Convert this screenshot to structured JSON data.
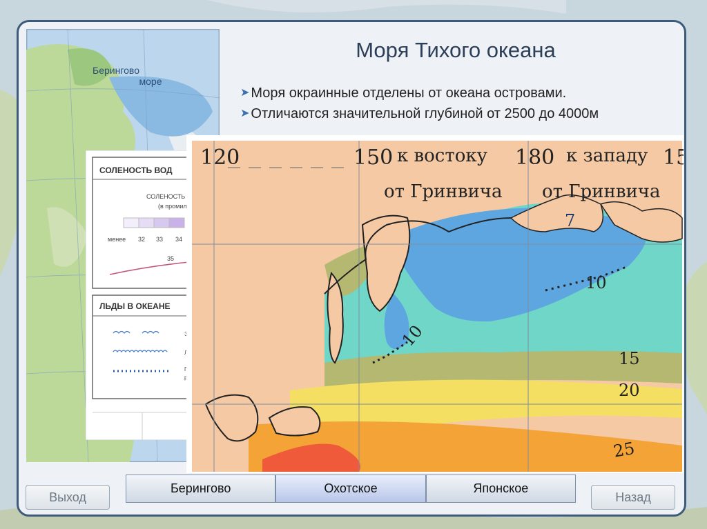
{
  "slide": {
    "title": "Моря Тихого океана",
    "bullets": [
      "Моря окраинные  отделены от океана островами.",
      "Отличаются значительной глубиной  от 2500 до 4000м"
    ]
  },
  "left_map": {
    "sea_label": "Берингово\nморе",
    "sea_label_line1": "Берингово",
    "sea_label_line2": "море"
  },
  "legend": {
    "salinity_title": "СОЛЕНОСТЬ ВОД",
    "salinity_sub": "СОЛЕНОСТЬ В",
    "salinity_unit": "(в промилл",
    "scale_prefix": "менее",
    "scale_values": [
      "32",
      "33",
      "34"
    ],
    "isoline_value": "35",
    "ice_title": "ЛЬДЫ В ОКЕАНЕ",
    "ice_items": [
      "Зим",
      "Лет",
      "Гра",
      "рас"
    ]
  },
  "main_map": {
    "lon_labels": [
      "120",
      "150",
      "180",
      "15"
    ],
    "east_label_1": "к востоку",
    "east_label_2": "от Гринвича",
    "west_label_1": "к западу",
    "west_label_2": "от Гринвича",
    "isotherms": [
      "7",
      "10",
      "10",
      "15",
      "20",
      "25"
    ]
  },
  "nav": {
    "exit_label": "Выход",
    "back_label": "Назад"
  },
  "tabs": [
    {
      "label": "Берингово"
    },
    {
      "label": "Охотское"
    },
    {
      "label": "Японское"
    }
  ],
  "colors": {
    "frame": "#3d5a7a",
    "title": "#2d3f58",
    "land": "#f4c9a4",
    "sea_cold": "#5ea6e0",
    "sea_teal": "#6fd6c8",
    "sea_olive": "#b4b870",
    "sea_yellow": "#f4df62",
    "sea_orange": "#f4a436",
    "sea_red": "#ee5a3a"
  }
}
